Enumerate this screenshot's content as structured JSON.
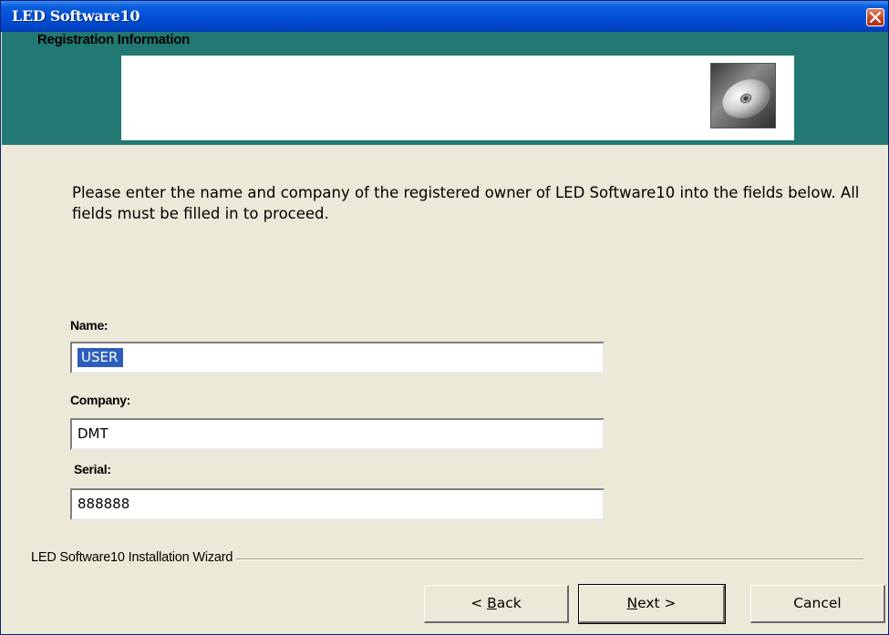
{
  "window": {
    "title": "LED Software10"
  },
  "header": {
    "title": "Registration Information",
    "icon": "cd-disc-icon"
  },
  "instructions": "Please enter the name and company of the registered owner of LED Software10 into the fields below. All fields must be filled in to proceed.",
  "form": {
    "name": {
      "label": "Name:",
      "value": "USER"
    },
    "company": {
      "label": "Company:",
      "value": "DMT"
    },
    "serial": {
      "label": "Serial:",
      "value": "888888"
    }
  },
  "footer": {
    "wizard_label": "LED Software10 Installation Wizard",
    "back_prefix": "< ",
    "back_mnemonic": "B",
    "back_rest": "ack",
    "next_mnemonic": "N",
    "next_rest": "ext >",
    "cancel_label": "Cancel"
  },
  "colors": {
    "titlebar": "#0050d8",
    "header_band": "#227872",
    "dialog_bg": "#ece9d8",
    "selection": "#2d5ebb"
  }
}
